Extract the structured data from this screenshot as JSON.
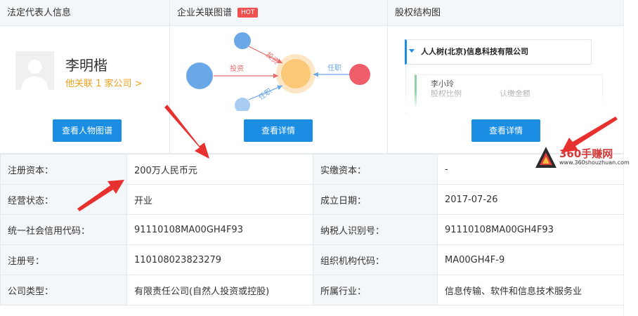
{
  "panels": {
    "legal": {
      "title": "法定代表人信息",
      "name": "李明楷",
      "link": "他关联 1 家公司 >",
      "button": "查看人物图谱"
    },
    "graph": {
      "title": "企业关联图谱",
      "badge": "HOT",
      "button": "查看详情",
      "edges": [
        "投资",
        "投资",
        "任职",
        "任职"
      ]
    },
    "equity": {
      "title": "股权结构图",
      "company": "人人树(北京)信息科技有限公司",
      "shareholder": "李小玲",
      "ratio_label": "股权比例",
      "amount_label": "认缴金额",
      "button": "查看详情"
    }
  },
  "info": {
    "rows": [
      {
        "l1": "注册资本：",
        "v1": "200万人民币元",
        "l2": "实缴资本：",
        "v2": "-"
      },
      {
        "l1": "经营状态：",
        "v1": "开业",
        "l2": "成立日期：",
        "v2": "2017-07-26"
      },
      {
        "l1": "统一社会信用代码：",
        "v1": "91110108MA00GH4F93",
        "l2": "纳税人识别号：",
        "v2": "91110108MA00GH4F93"
      },
      {
        "l1": "注册号：",
        "v1": "110108023823279",
        "l2": "组织机构代码：",
        "v2": "MA00GH4F-9"
      },
      {
        "l1": "公司类型：",
        "v1": "有限责任公司(自然人投资或控股)",
        "l2": "所属行业：",
        "v2": "信息传输、软件和信息技术服务业"
      }
    ]
  },
  "watermark": {
    "text": "360手赚网",
    "url": "www.360shouzhuan.com"
  },
  "colors": {
    "accent": "#1b8ee3",
    "hot": "#f04f4f",
    "link": "#f0a11b",
    "arrow": "#e8302f"
  }
}
